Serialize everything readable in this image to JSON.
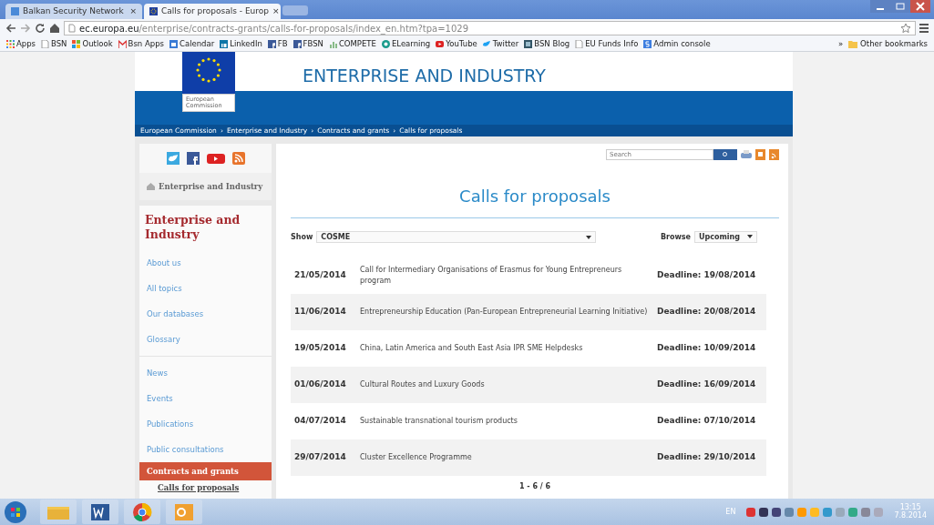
{
  "browser": {
    "tabs": [
      {
        "title": "Balkan Security Network",
        "close": "×",
        "selected": false
      },
      {
        "title": "Calls for proposals - Europ",
        "close": "×",
        "selected": true
      }
    ],
    "address": {
      "domain": "ec.europa.eu",
      "path": "/enterprise/contracts-grants/calls-for-proposals/index_en.htm?tpa=1029"
    },
    "bookmarks": [
      {
        "label": "Apps",
        "kind": "apps"
      },
      {
        "label": "BSN",
        "kind": "page"
      },
      {
        "label": "Outlook",
        "kind": "grid"
      },
      {
        "label": "Bsn Apps",
        "kind": "mail"
      },
      {
        "label": "Calendar",
        "kind": "calendar"
      },
      {
        "label": "LinkedIn",
        "kind": "linkedin"
      },
      {
        "label": "FB",
        "kind": "facebook"
      },
      {
        "label": "FBSN",
        "kind": "facebook"
      },
      {
        "label": "COMPETE",
        "kind": "bars"
      },
      {
        "label": "ELearning",
        "kind": "globe"
      },
      {
        "label": "YouTube",
        "kind": "youtube"
      },
      {
        "label": "Twitter",
        "kind": "twitter"
      },
      {
        "label": "BSN Blog",
        "kind": "square"
      },
      {
        "label": "EU Funds Info",
        "kind": "page"
      },
      {
        "label": "Admin console",
        "kind": "admin"
      }
    ],
    "bookmarks_overflow": "»",
    "other_bookmarks": "Other bookmarks"
  },
  "site": {
    "logo_text": [
      "European",
      "Commission"
    ],
    "title": "ENTERPRISE AND INDUSTRY",
    "breadcrumb_separator": "›",
    "breadcrumb": [
      "European Commission",
      "Enterprise and Industry",
      "Contracts and grants",
      "Calls for proposals"
    ],
    "home_link": "Enterprise and Industry",
    "section_title": "Enterprise and Industry",
    "nav_groups": [
      [
        {
          "label": "About us",
          "selected": false
        },
        {
          "label": "All topics",
          "selected": false
        },
        {
          "label": "Our databases",
          "selected": false
        },
        {
          "label": "Glossary",
          "selected": false
        }
      ],
      [
        {
          "label": "News",
          "selected": false
        },
        {
          "label": "Events",
          "selected": false
        },
        {
          "label": "Publications",
          "selected": false
        },
        {
          "label": "Public consultations",
          "selected": false
        },
        {
          "label": "Contracts and grants",
          "selected": true,
          "children": [
            {
              "label": "Calls for proposals"
            }
          ]
        }
      ]
    ],
    "search": {
      "placeholder": "Search"
    },
    "heading": "Calls for proposals",
    "filter": {
      "show_label": "Show",
      "show_value": "COSME",
      "browse_label": "Browse",
      "browse_value": "Upcoming"
    },
    "calls": [
      {
        "date": "21/05/2014",
        "title": "Call for Intermediary Organisations of Erasmus for Young Entrepreneurs program",
        "deadline": "Deadline: 19/08/2014"
      },
      {
        "date": "11/06/2014",
        "title": "Entrepreneurship Education (Pan-European Entrepreneurial Learning Initiative)",
        "deadline": "Deadline: 20/08/2014"
      },
      {
        "date": "19/05/2014",
        "title": "China, Latin America and South East Asia IPR SME Helpdesks",
        "deadline": "Deadline: 10/09/2014"
      },
      {
        "date": "01/06/2014",
        "title": "Cultural Routes and Luxury Goods",
        "deadline": "Deadline: 16/09/2014"
      },
      {
        "date": "04/07/2014",
        "title": "Sustainable transnational tourism products",
        "deadline": "Deadline: 07/10/2014"
      },
      {
        "date": "29/07/2014",
        "title": "Cluster Excellence Programme",
        "deadline": "Deadline: 29/10/2014"
      }
    ],
    "pager": "1 - 6 / 6"
  },
  "taskbar": {
    "apps": [
      {
        "kind": "explorer"
      },
      {
        "kind": "word"
      },
      {
        "kind": "chrome"
      },
      {
        "kind": "outlook"
      }
    ],
    "language": "EN",
    "time": "13:15",
    "date": "7.8.2014"
  }
}
